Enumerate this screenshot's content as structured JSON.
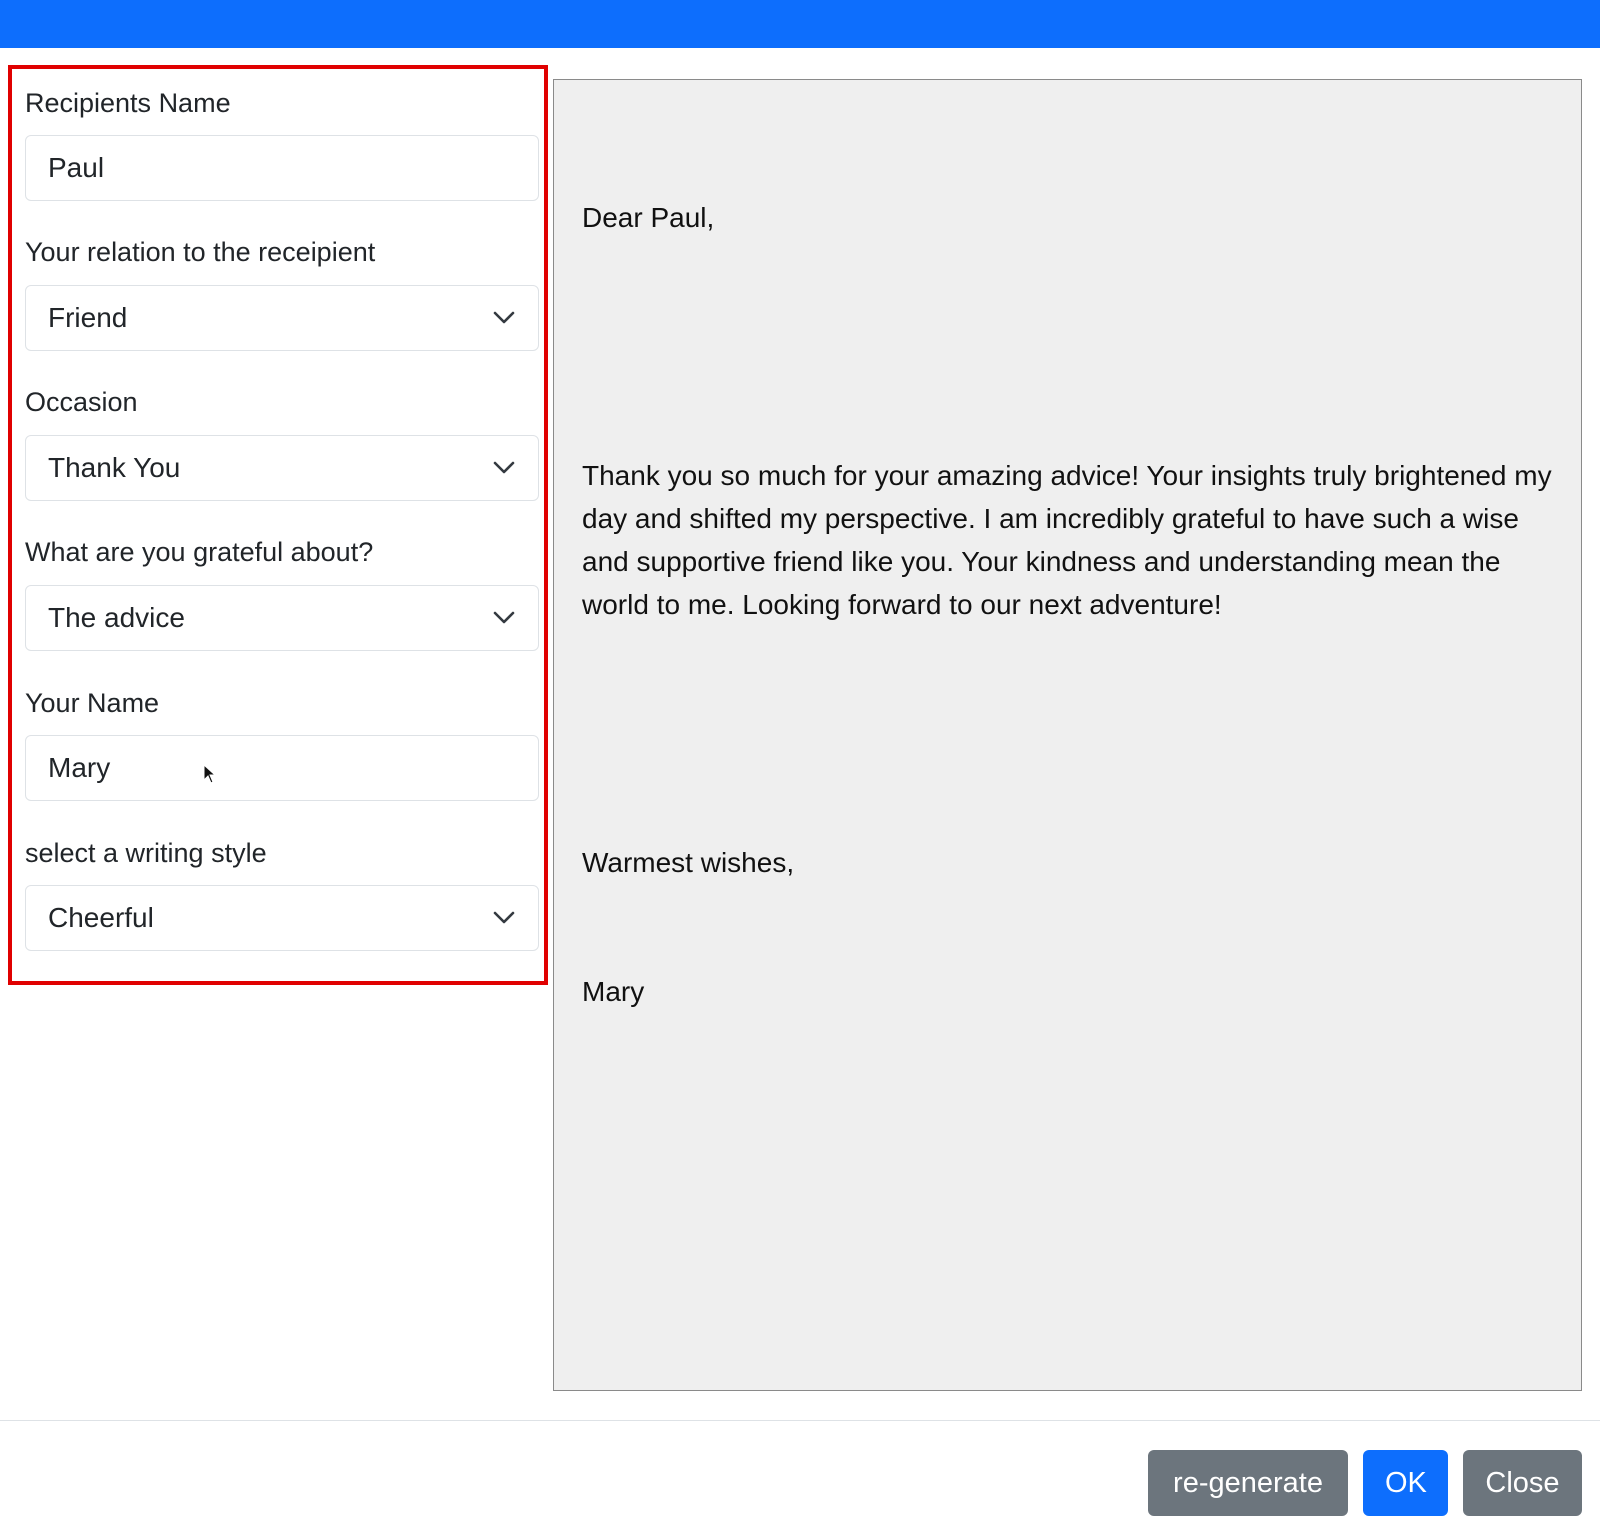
{
  "form": {
    "recipient_name": {
      "label": "Recipients Name",
      "value": "Paul"
    },
    "relation": {
      "label": "Your relation to the receipient",
      "selected": "Friend"
    },
    "occasion": {
      "label": "Occasion",
      "selected": "Thank You"
    },
    "grateful_about": {
      "label": "What are you grateful about?",
      "selected": "The advice"
    },
    "your_name": {
      "label": "Your Name",
      "value": "Mary"
    },
    "writing_style": {
      "label": "select a writing style",
      "selected": "Cheerful"
    }
  },
  "letter": {
    "greeting": "Dear Paul,",
    "body": "Thank you so much for your amazing advice! Your insights truly brightened my day and shifted my perspective. I am incredibly grateful to have such a wise and supportive friend like you. Your kindness and understanding mean the world to me. Looking forward to our next adventure!",
    "closing": "Warmest wishes,",
    "signature": "Mary"
  },
  "buttons": {
    "regenerate": "re-generate",
    "ok": "OK",
    "close": "Close"
  },
  "icons": {
    "select_chevron": "chevron-down-icon",
    "resize": "resize-handle-icon",
    "cursor": "mouse-pointer-icon"
  },
  "colors": {
    "topbar": "#0d6efd",
    "highlight_border": "#e00000",
    "letter_background": "#efefef",
    "secondary_button": "#6c757d",
    "primary_button": "#0d6efd"
  }
}
